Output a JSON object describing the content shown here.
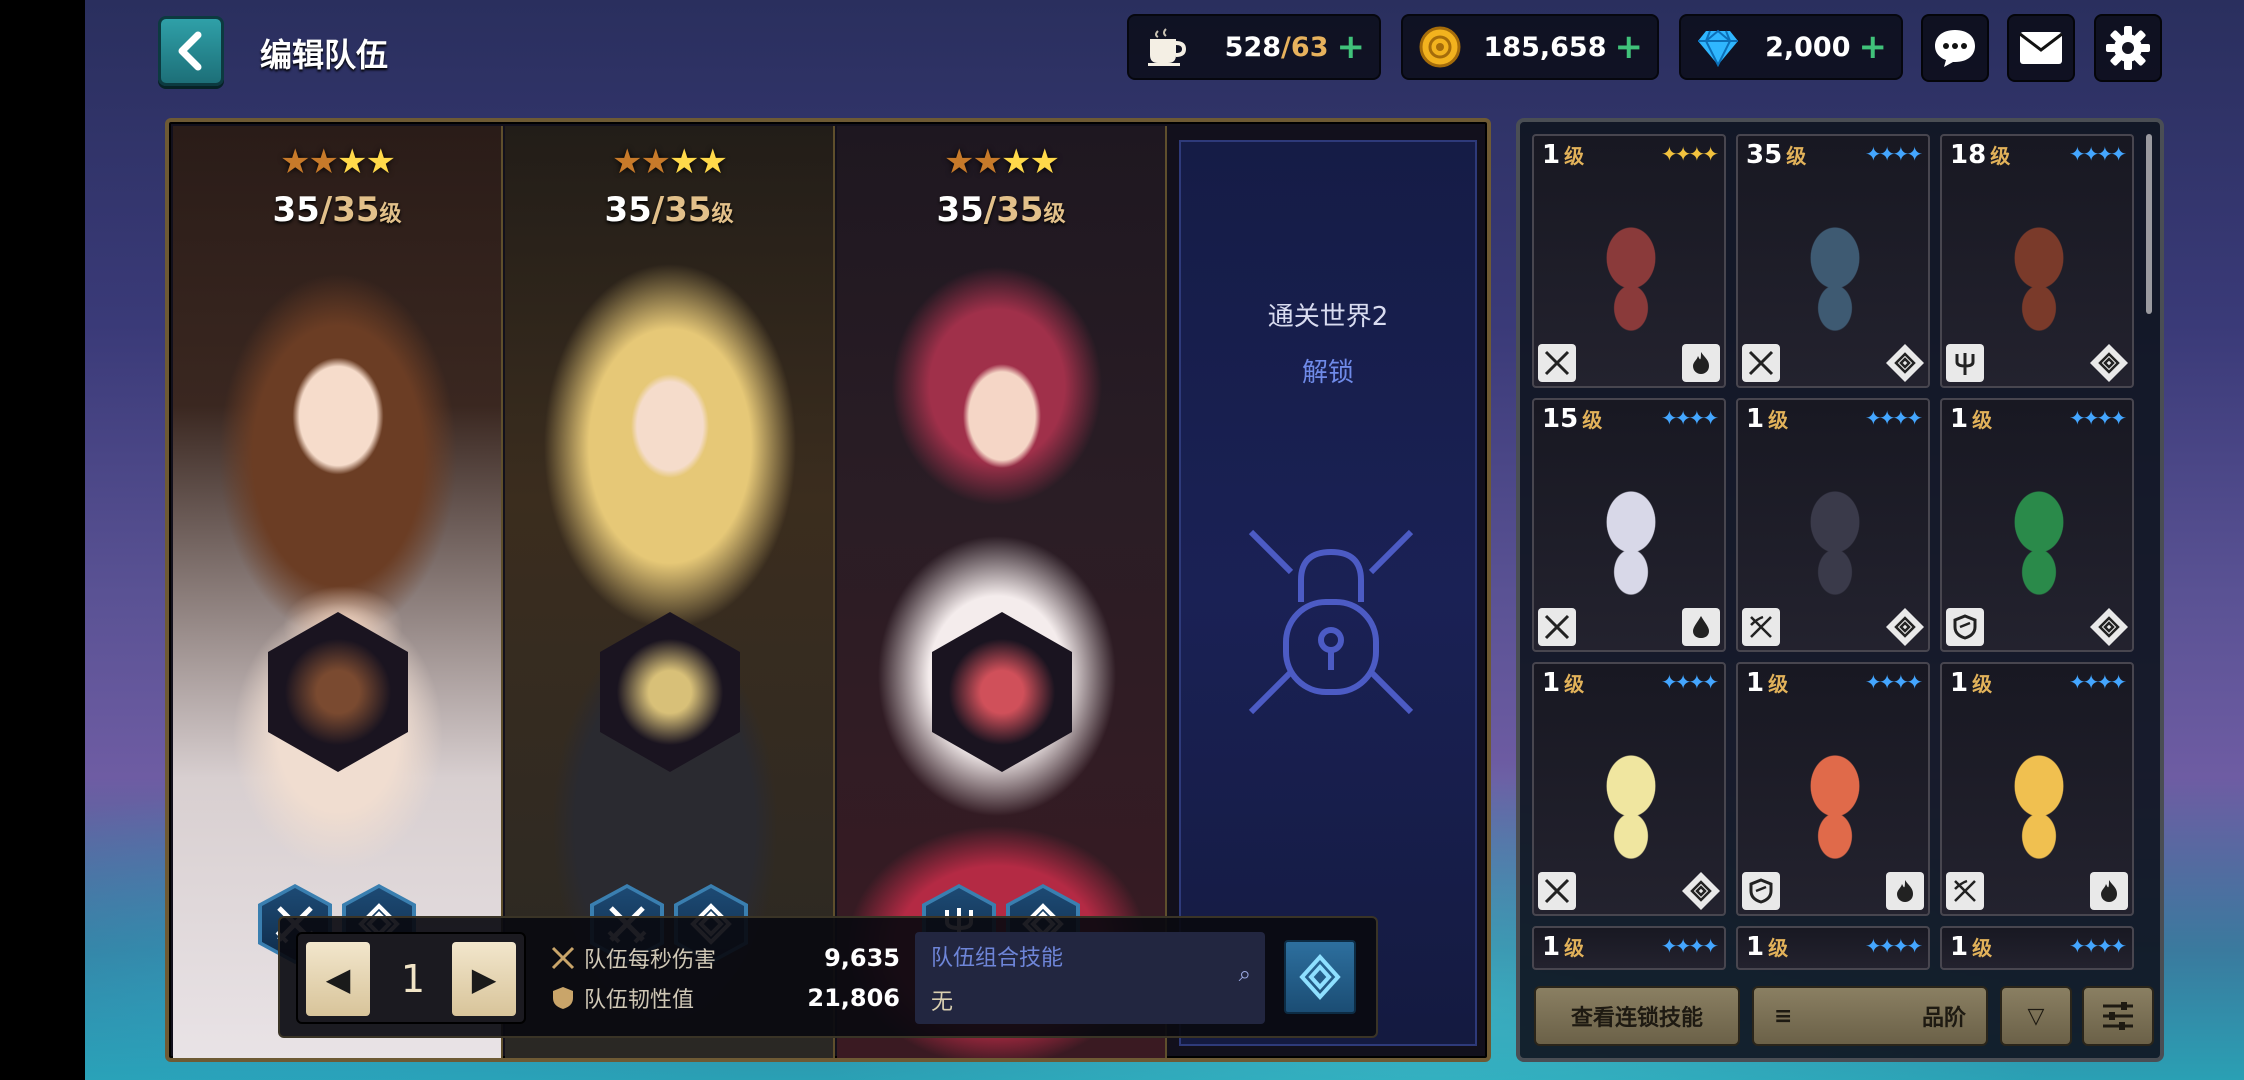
{
  "header": {
    "title": "编辑队伍",
    "stamina": {
      "current": "528",
      "max": "63"
    },
    "gold": "185,658",
    "gems": "2,000"
  },
  "team": {
    "slots": [
      {
        "name": "slot-1",
        "stars_total": 4,
        "stars_dim": 2,
        "level": "35",
        "level_max": "35",
        "level_unit": "级",
        "roles": [
          "swords-icon",
          "spiral-icon"
        ]
      },
      {
        "name": "slot-2",
        "stars_total": 4,
        "stars_dim": 2,
        "level": "35",
        "level_max": "35",
        "level_unit": "级",
        "roles": [
          "swords-icon",
          "spiral-icon"
        ]
      },
      {
        "name": "slot-3",
        "stars_total": 4,
        "stars_dim": 2,
        "level": "35",
        "level_max": "35",
        "level_unit": "级",
        "roles": [
          "trident-icon",
          "spiral-icon"
        ]
      }
    ],
    "locked_slot": {
      "requirement": "通关世界2",
      "unlock_label": "解锁"
    },
    "page_number": "1",
    "dps_label": "队伍每秒伤害",
    "dps_value": "9,635",
    "toughness_label": "队伍韧性值",
    "toughness_value": "21,806",
    "combo_title": "队伍组合技能",
    "combo_value": "无"
  },
  "roster": {
    "cards": [
      {
        "level": "1",
        "unit": "级",
        "star_color": "gold",
        "role": "swords-icon",
        "element": "fire-icon"
      },
      {
        "level": "35",
        "unit": "级",
        "star_color": "blue",
        "role": "swords-icon",
        "element": "spiral-icon"
      },
      {
        "level": "18",
        "unit": "级",
        "star_color": "blue",
        "role": "trident-icon",
        "element": "spiral-icon"
      },
      {
        "level": "15",
        "unit": "级",
        "star_color": "blue",
        "role": "swords-icon",
        "element": "water-icon"
      },
      {
        "level": "1",
        "unit": "级",
        "star_color": "blue",
        "role": "crossed-bows-icon",
        "element": "spiral-icon"
      },
      {
        "level": "1",
        "unit": "级",
        "star_color": "blue",
        "role": "shield-icon",
        "element": "spiral-icon"
      },
      {
        "level": "1",
        "unit": "级",
        "star_color": "blue",
        "role": "swords-icon",
        "element": "spiral-icon"
      },
      {
        "level": "1",
        "unit": "级",
        "star_color": "blue",
        "role": "shield-icon",
        "element": "fire-icon"
      },
      {
        "level": "1",
        "unit": "级",
        "star_color": "blue",
        "role": "crossed-bows-icon",
        "element": "fire-icon"
      },
      {
        "level": "1",
        "unit": "级",
        "star_color": "blue",
        "role": "",
        "element": ""
      },
      {
        "level": "1",
        "unit": "级",
        "star_color": "blue",
        "role": "",
        "element": ""
      },
      {
        "level": "1",
        "unit": "级",
        "star_color": "blue",
        "role": "",
        "element": ""
      }
    ],
    "chain_skill_button": "查看连锁技能",
    "sort_label": "品阶"
  },
  "colors": {
    "accent_teal": "#2fa0a8",
    "gold_text": "#e2b25a",
    "blue_star": "#44a6ff",
    "plus_green": "#40c27a"
  }
}
